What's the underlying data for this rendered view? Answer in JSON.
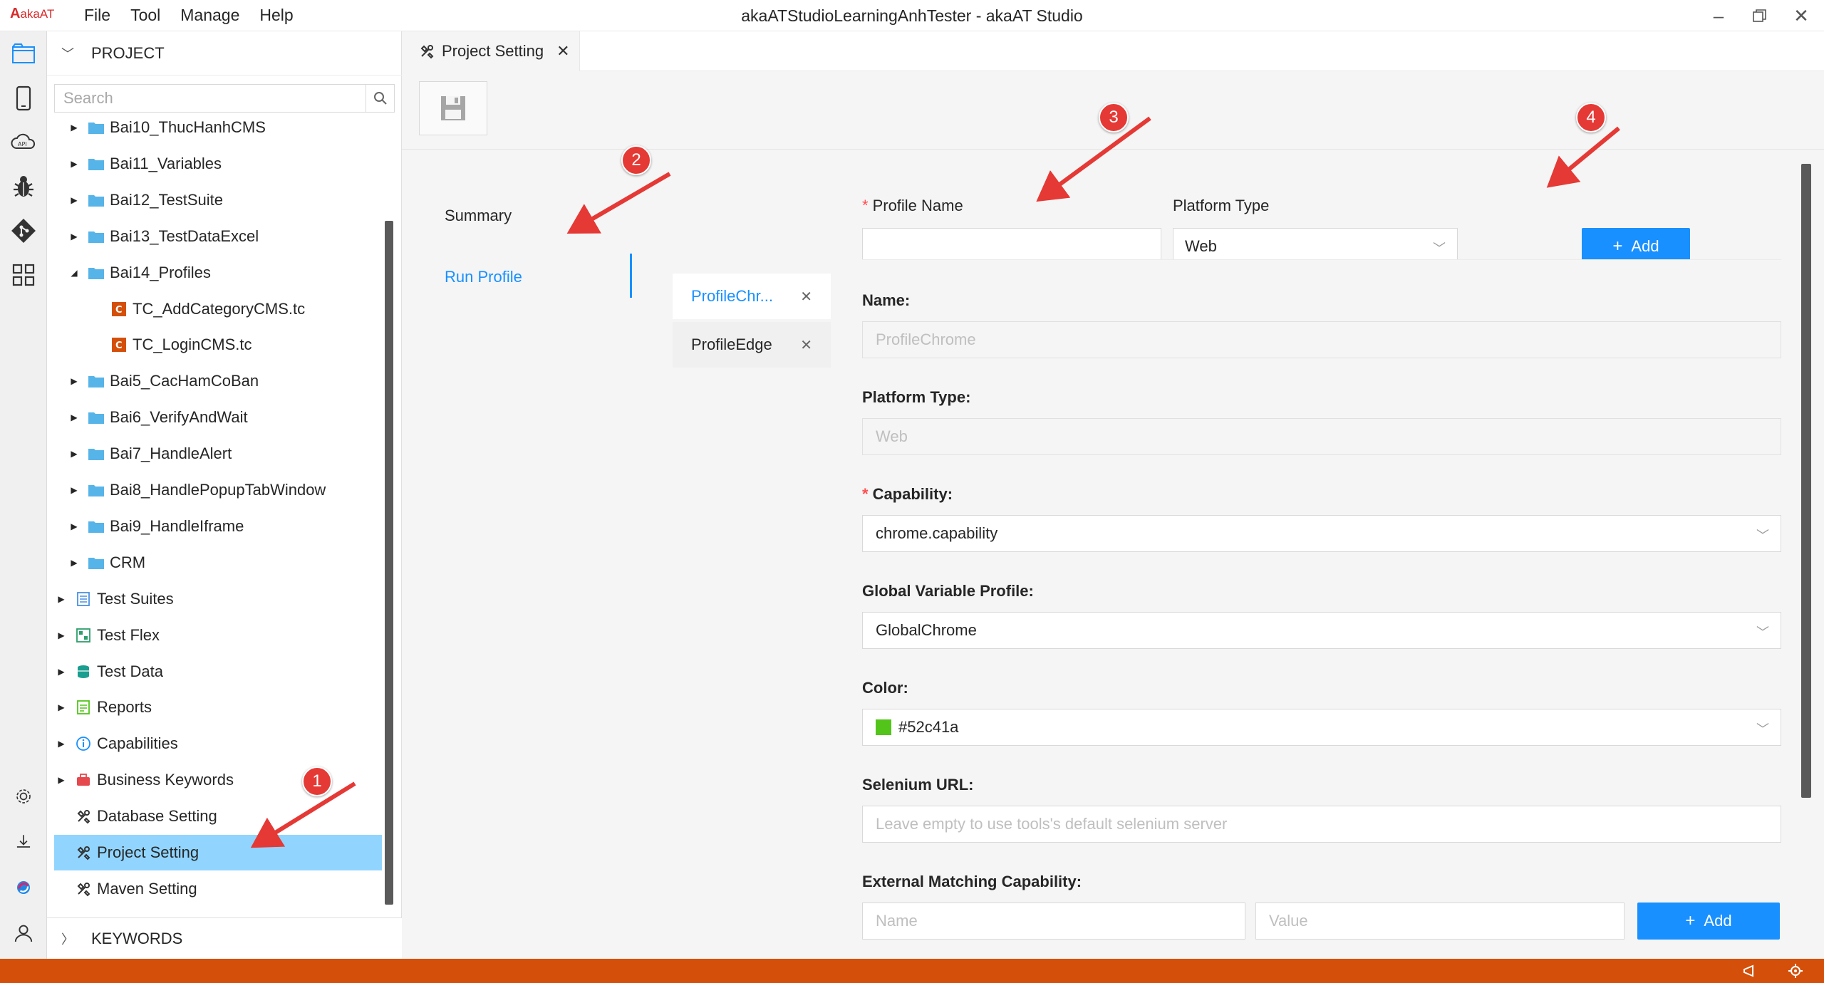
{
  "window": {
    "logo_mark": "A",
    "logo_text": "akaAT",
    "title": "akaATStudioLearningAnhTester - akaAT Studio",
    "menu": [
      "File",
      "Tool",
      "Manage",
      "Help"
    ]
  },
  "activity_bar": {
    "icons": [
      "project-folder-icon",
      "mobile-icon",
      "api-cloud-icon",
      "bug-icon",
      "git-icon",
      "grid-apps-icon",
      "settings-icon",
      "download-icon",
      "brand-swirl-icon",
      "user-icon"
    ]
  },
  "explorer": {
    "header": "PROJECT",
    "search_placeholder": "Search",
    "items": [
      {
        "label": "Bai10_ThucHanhCMS",
        "type": "folder",
        "level": 1,
        "expanded": false
      },
      {
        "label": "Bai11_Variables",
        "type": "folder",
        "level": 1,
        "expanded": false
      },
      {
        "label": "Bai12_TestSuite",
        "type": "folder",
        "level": 1,
        "expanded": false
      },
      {
        "label": "Bai13_TestDataExcel",
        "type": "folder",
        "level": 1,
        "expanded": false
      },
      {
        "label": "Bai14_Profiles",
        "type": "folder",
        "level": 1,
        "expanded": true
      },
      {
        "label": "TC_AddCategoryCMS.tc",
        "type": "testcase",
        "level": 2
      },
      {
        "label": "TC_LoginCMS.tc",
        "type": "testcase",
        "level": 2
      },
      {
        "label": "Bai5_CacHamCoBan",
        "type": "folder",
        "level": 1,
        "expanded": false
      },
      {
        "label": "Bai6_VerifyAndWait",
        "type": "folder",
        "level": 1,
        "expanded": false
      },
      {
        "label": "Bai7_HandleAlert",
        "type": "folder",
        "level": 1,
        "expanded": false
      },
      {
        "label": "Bai8_HandlePopupTabWindow",
        "type": "folder",
        "level": 1,
        "expanded": false
      },
      {
        "label": "Bai9_HandleIframe",
        "type": "folder",
        "level": 1,
        "expanded": false
      },
      {
        "label": "CRM",
        "type": "folder",
        "level": 1,
        "expanded": false
      },
      {
        "label": "Test Suites",
        "type": "suites",
        "level": 0,
        "expanded": false
      },
      {
        "label": "Test Flex",
        "type": "flex",
        "level": 0,
        "expanded": false
      },
      {
        "label": "Test Data",
        "type": "data",
        "level": 0,
        "expanded": false
      },
      {
        "label": "Reports",
        "type": "reports",
        "level": 0,
        "expanded": false
      },
      {
        "label": "Capabilities",
        "type": "capabilities",
        "level": 0,
        "expanded": false
      },
      {
        "label": "Business Keywords",
        "type": "keywords",
        "level": 0,
        "expanded": false
      },
      {
        "label": "Database Setting",
        "type": "setting",
        "level": 0
      },
      {
        "label": "Project Setting",
        "type": "setting",
        "level": 0,
        "selected": true
      },
      {
        "label": "Maven Setting",
        "type": "setting",
        "level": 0
      }
    ],
    "keywords_header": "KEYWORDS"
  },
  "editor": {
    "tab_label": "Project Setting",
    "nav": {
      "summary": "Summary",
      "run_profile": "Run Profile"
    },
    "profiles": [
      {
        "label": "ProfileChr...",
        "active": true
      },
      {
        "label": "ProfileEdge",
        "active": false
      }
    ],
    "add_form": {
      "profile_name_label": "Profile Name",
      "profile_name_value": "",
      "platform_type_label": "Platform Type",
      "platform_type_value": "Web",
      "add_label": "Add"
    },
    "detail": {
      "name_label": "Name:",
      "name_value": "ProfileChrome",
      "platform_label": "Platform Type:",
      "platform_value": "Web",
      "capability_label": "Capability:",
      "capability_value": "chrome.capability",
      "gvp_label": "Global Variable Profile:",
      "gvp_value": "GlobalChrome",
      "color_label": "Color:",
      "color_value": "#52c41a",
      "selenium_label": "Selenium URL:",
      "selenium_placeholder": "Leave empty to use tools's default selenium server",
      "emc_label": "External Matching Capability:",
      "emc_name_placeholder": "Name",
      "emc_value_placeholder": "Value",
      "emc_add_label": "Add"
    }
  },
  "annotations": {
    "badges": [
      "1",
      "2",
      "3",
      "4"
    ],
    "color": "#e53935"
  },
  "colors": {
    "accent": "#1890ff",
    "selected_row": "#91d5ff",
    "statusbar": "#d4500a",
    "required": "#ff4d4f"
  }
}
